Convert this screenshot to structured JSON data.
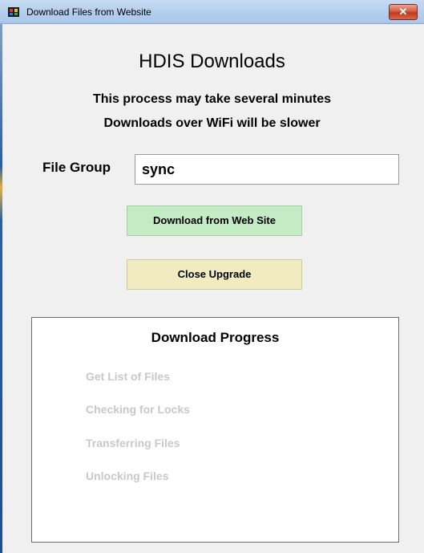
{
  "window": {
    "title": "Download Files from Website",
    "close_glyph": "✕"
  },
  "main": {
    "heading": "HDIS Downloads",
    "notice_line1": "This process may take several minutes",
    "notice_line2": "Downloads over WiFi will be slower",
    "file_group_label": "File Group",
    "file_group_value": "sync",
    "download_button_label": "Download from Web Site",
    "close_button_label": "Close Upgrade"
  },
  "progress": {
    "title": "Download Progress",
    "steps": [
      {
        "label": "Get List of Files"
      },
      {
        "label": "Checking for Locks"
      },
      {
        "label": "Transferring Files"
      },
      {
        "label": "Unlocking Files"
      }
    ]
  },
  "colors": {
    "download_button_bg": "#c4ecc4",
    "close_button_bg": "#f0ecc0",
    "inactive_step_text": "#c8c8c8",
    "titlebar_bg": "#b5cfee"
  },
  "icons": {
    "title_icon": "app-icon",
    "close_icon": "close-icon"
  }
}
